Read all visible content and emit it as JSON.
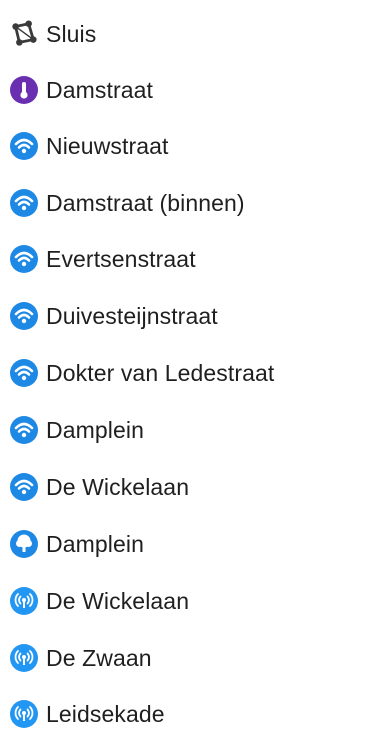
{
  "colors": {
    "wifi": "#1e88e5",
    "thermometer": "#6a2fb0",
    "tree": "#1e88e5",
    "broadcast": "#2196f3",
    "sluice": "#3a3a3a"
  },
  "items": [
    {
      "label": "Sluis",
      "icon": "sluice-icon"
    },
    {
      "label": "Damstraat",
      "icon": "thermometer-icon"
    },
    {
      "label": "Nieuwstraat",
      "icon": "wifi-icon"
    },
    {
      "label": "Damstraat (binnen)",
      "icon": "wifi-icon"
    },
    {
      "label": "Evertsenstraat",
      "icon": "wifi-icon"
    },
    {
      "label": "Duivesteijnstraat",
      "icon": "wifi-icon"
    },
    {
      "label": "Dokter van Ledestraat",
      "icon": "wifi-icon"
    },
    {
      "label": "Damplein",
      "icon": "wifi-icon"
    },
    {
      "label": "De Wickelaan",
      "icon": "wifi-icon"
    },
    {
      "label": "Damplein",
      "icon": "tree-icon"
    },
    {
      "label": "De Wickelaan",
      "icon": "broadcast-icon"
    },
    {
      "label": "De Zwaan",
      "icon": "broadcast-icon"
    },
    {
      "label": "Leidsekade",
      "icon": "broadcast-icon"
    }
  ]
}
